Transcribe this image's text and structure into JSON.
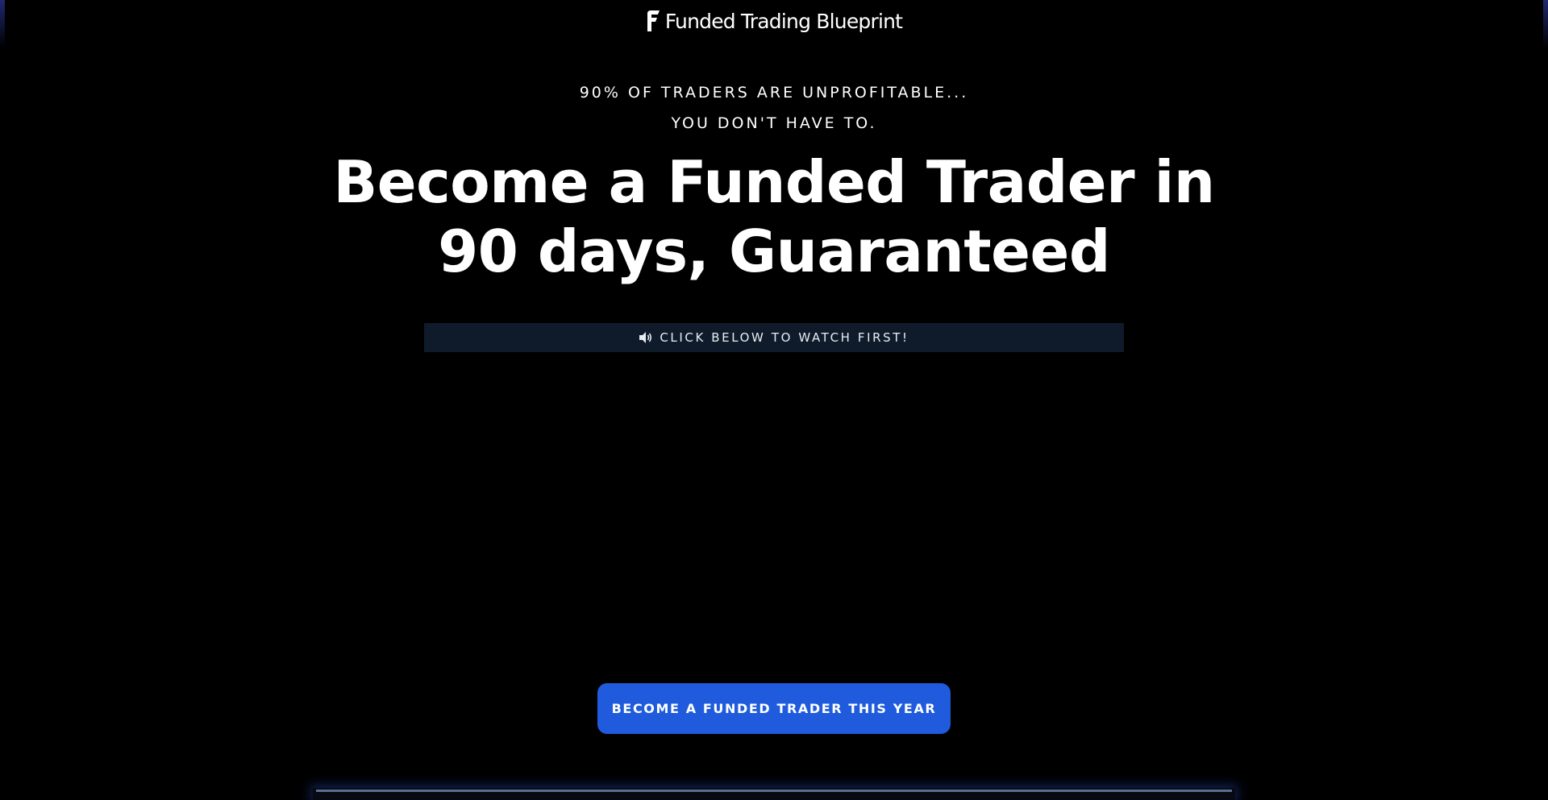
{
  "header": {
    "logo_text": "Funded Trading Blueprint",
    "logo_icon": "f-logo-mark-icon"
  },
  "hero": {
    "pre_headline_1": "90% OF TRADERS ARE UNPROFITABLE...",
    "pre_headline_2": "YOU DON'T HAVE TO.",
    "headline": "Become a Funded Trader in 90 days, Guaranteed"
  },
  "video": {
    "bar_icon": "speaker-icon",
    "bar_label": "CLICK BELOW TO WATCH FIRST!"
  },
  "cta": {
    "label": "BECOME A FUNDED TRADER THIS YEAR"
  },
  "colors": {
    "background": "#000000",
    "accent": "#1f5bdc",
    "watch_bar": "#0f1b2a"
  }
}
